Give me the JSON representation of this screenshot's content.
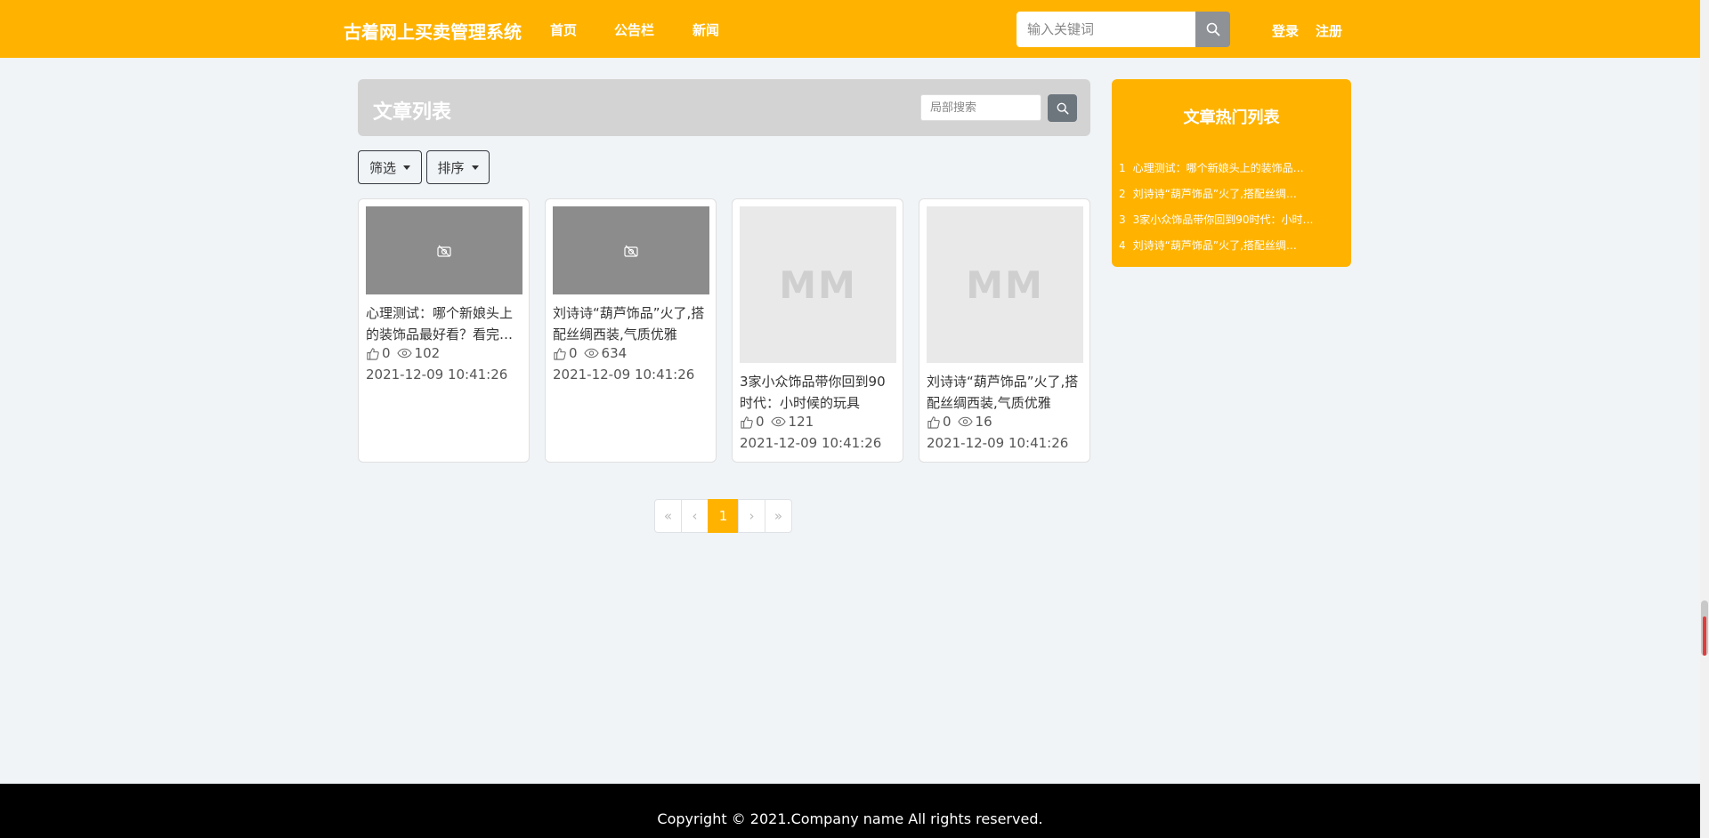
{
  "header": {
    "brand": "古着网上买卖管理系统",
    "nav": [
      "首页",
      "公告栏",
      "新闻"
    ],
    "search_placeholder": "输入关键词",
    "login": "登录",
    "register": "注册"
  },
  "list": {
    "title": "文章列表",
    "local_search_placeholder": "局部搜索",
    "filter_label": "筛选",
    "sort_label": "排序"
  },
  "cards": [
    {
      "thumb": "broken-image",
      "title": "心理测试：哪个新娘头上的装饰品最好看？看完你就知道了",
      "likes": "0",
      "views": "102",
      "date": "2021-12-09 10:41:26"
    },
    {
      "thumb": "broken-image",
      "title": "刘诗诗“葫芦饰品”火了,搭配丝绸西装,气质优雅",
      "likes": "0",
      "views": "634",
      "date": "2021-12-09 10:41:26"
    },
    {
      "thumb": "MM",
      "title": "3家小众饰品带你回到90时代：小时候的玩具",
      "likes": "0",
      "views": "121",
      "date": "2021-12-09 10:41:26"
    },
    {
      "thumb": "MM",
      "title": "刘诗诗“葫芦饰品”火了,搭配丝绸西装,气质优雅",
      "likes": "0",
      "views": "16",
      "date": "2021-12-09 10:41:26"
    }
  ],
  "pagination": {
    "first": "«",
    "prev": "‹",
    "current": "1",
    "next": "›",
    "last": "»"
  },
  "hot": {
    "title": "文章热门列表",
    "items": [
      {
        "num": "1",
        "text": "心理测试：哪个新娘头上的装饰品…"
      },
      {
        "num": "2",
        "text": "刘诗诗“葫芦饰品”火了,搭配丝绸…"
      },
      {
        "num": "3",
        "text": "3家小众饰品带你回到90时代：小时…"
      },
      {
        "num": "4",
        "text": "刘诗诗“葫芦饰品”火了,搭配丝绸…"
      }
    ]
  },
  "footer": {
    "copyright": "Copyright © 2021.Company name All rights reserved."
  },
  "colors": {
    "primary": "#ffb300",
    "footer_bg": "#000000",
    "page_bg": "#f0f4f7"
  }
}
